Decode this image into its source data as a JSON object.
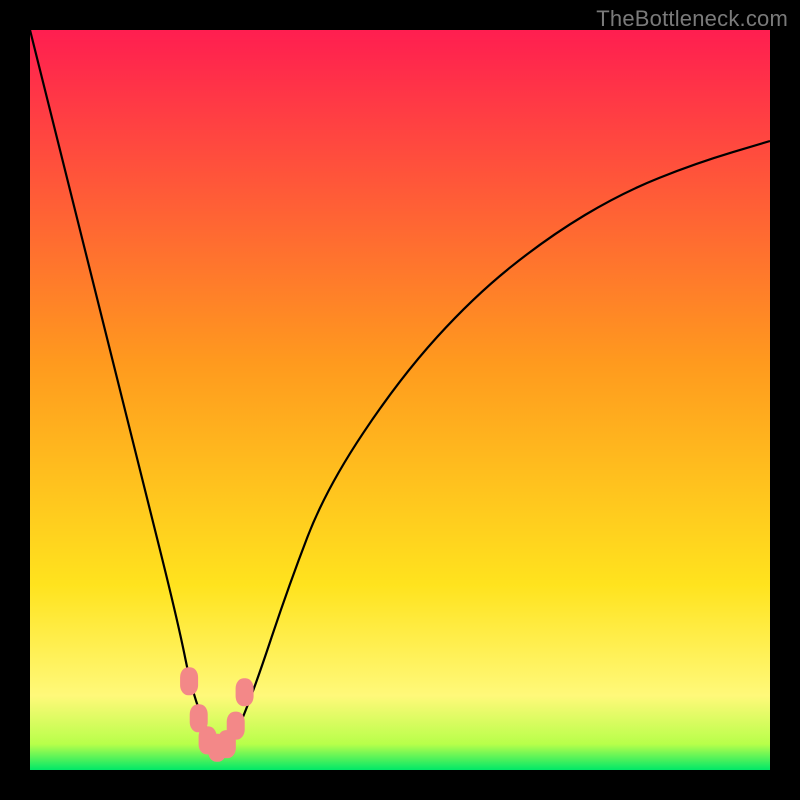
{
  "watermark": "TheBottleneck.com",
  "chart_data": {
    "type": "line",
    "title": "",
    "xlabel": "",
    "ylabel": "",
    "xlim": [
      0,
      100
    ],
    "ylim": [
      0,
      100
    ],
    "grid": false,
    "legend": false,
    "background_gradient": {
      "stops": [
        {
          "offset": 0.0,
          "color": "#ff1e50"
        },
        {
          "offset": 0.45,
          "color": "#ff9a1e"
        },
        {
          "offset": 0.75,
          "color": "#ffe31e"
        },
        {
          "offset": 0.9,
          "color": "#fff97a"
        },
        {
          "offset": 0.965,
          "color": "#b8ff4a"
        },
        {
          "offset": 1.0,
          "color": "#00e868"
        }
      ]
    },
    "series": [
      {
        "name": "bottleneck-curve",
        "x": [
          0,
          5,
          10,
          15,
          20,
          22,
          25,
          27,
          30,
          35,
          40,
          50,
          60,
          70,
          80,
          90,
          100
        ],
        "y": [
          100,
          80,
          60,
          40,
          20,
          10,
          3,
          3,
          10,
          25,
          38,
          53,
          64,
          72,
          78,
          82,
          85
        ]
      }
    ],
    "markers": {
      "name": "highlight-region",
      "color": "#f38888",
      "points": [
        {
          "x": 21.5,
          "y": 12
        },
        {
          "x": 22.8,
          "y": 7
        },
        {
          "x": 24.0,
          "y": 4
        },
        {
          "x": 25.3,
          "y": 3
        },
        {
          "x": 26.6,
          "y": 3.5
        },
        {
          "x": 27.8,
          "y": 6
        },
        {
          "x": 29.0,
          "y": 10.5
        }
      ]
    }
  }
}
